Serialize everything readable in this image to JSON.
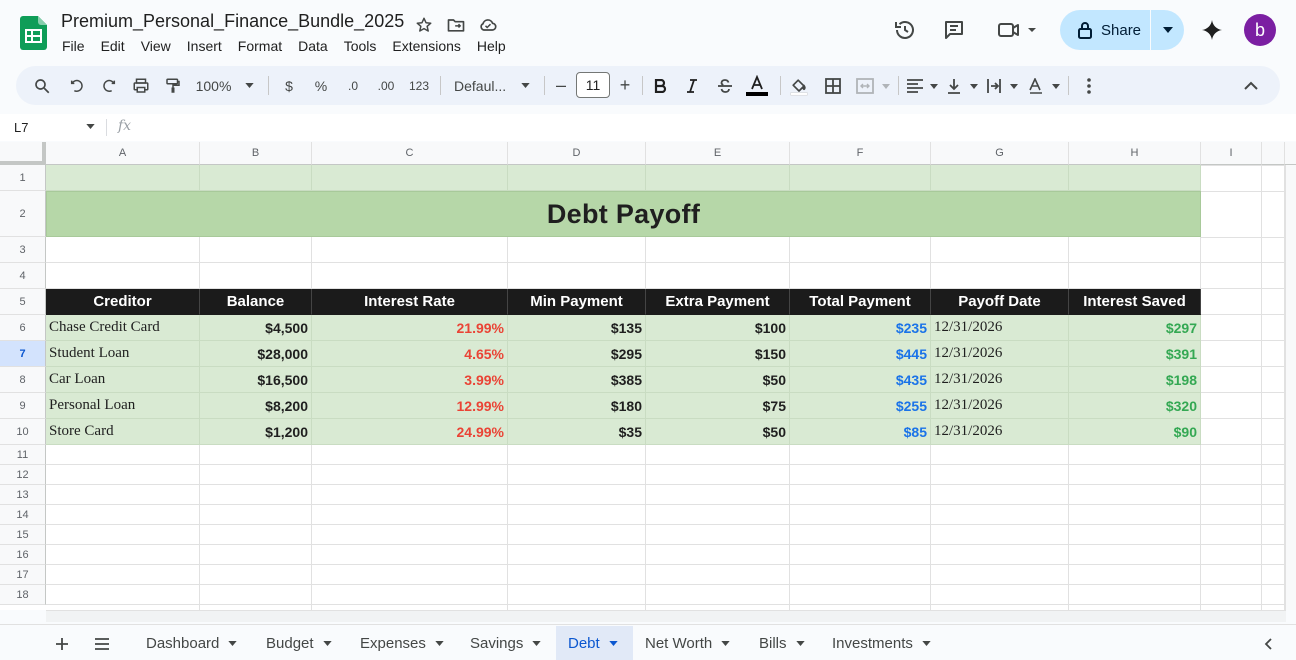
{
  "app": {
    "doc_title": "Premium_Personal_Finance_Bundle_2025",
    "menus": [
      "File",
      "Edit",
      "View",
      "Insert",
      "Format",
      "Data",
      "Tools",
      "Extensions",
      "Help"
    ],
    "share_label": "Share",
    "avatar_letter": "b",
    "accent_color": "#c2e7ff"
  },
  "toolbar": {
    "zoom": "100%",
    "currency": "$",
    "percent": "%",
    "dec_decrease": ".0",
    "dec_increase": ".00",
    "number_format": "123",
    "font_name": "Defaul...",
    "font_size": "11",
    "minus": "–",
    "plus": "+"
  },
  "formula_bar": {
    "cell_ref": "L7",
    "fx": "fx"
  },
  "columns": [
    "A",
    "B",
    "C",
    "D",
    "E",
    "F",
    "G",
    "H",
    "I"
  ],
  "rows": [
    "1",
    "2",
    "3",
    "4",
    "5",
    "6",
    "7",
    "8",
    "9",
    "10",
    "11",
    "12",
    "13",
    "14",
    "15",
    "16",
    "17",
    "18"
  ],
  "selected_row": "7",
  "sheet": {
    "title": "Debt Payoff",
    "headers": [
      "Creditor",
      "Balance",
      "Interest Rate",
      "Min Payment",
      "Extra Payment",
      "Total Payment",
      "Payoff Date",
      "Interest Saved"
    ],
    "data": [
      [
        "Chase Credit Card",
        "$4,500",
        "21.99%",
        "$135",
        "$100",
        "$235",
        "12/31/2026",
        "$297"
      ],
      [
        "Student Loan",
        "$28,000",
        "4.65%",
        "$295",
        "$150",
        "$445",
        "12/31/2026",
        "$391"
      ],
      [
        "Car Loan",
        "$16,500",
        "3.99%",
        "$385",
        "$50",
        "$435",
        "12/31/2026",
        "$198"
      ],
      [
        "Personal Loan",
        "$8,200",
        "12.99%",
        "$180",
        "$75",
        "$255",
        "12/31/2026",
        "$320"
      ],
      [
        "Store Card",
        "$1,200",
        "24.99%",
        "$35",
        "$50",
        "$85",
        "12/31/2026",
        "$90"
      ]
    ],
    "colors": {
      "title_band": "#b6d7a8",
      "row_fill": "#d9ead3",
      "header_fill": "#1b1b1b",
      "rate_text": "#ea4335",
      "total_text": "#1a73e8",
      "saved_text": "#34a853"
    }
  },
  "tabs": {
    "items": [
      "Dashboard",
      "Budget",
      "Expenses",
      "Savings",
      "Debt",
      "Net Worth",
      "Bills",
      "Investments"
    ],
    "active": "Debt"
  }
}
